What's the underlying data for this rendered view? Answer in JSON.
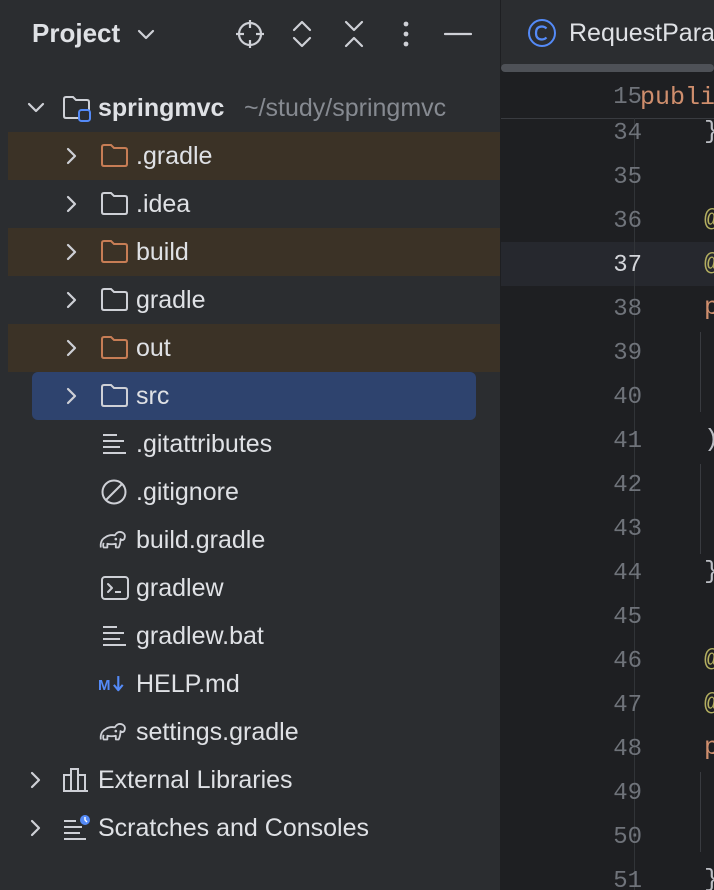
{
  "panel": {
    "title": "Project",
    "header_icons": [
      "crosshair-icon",
      "expand-icon",
      "collapse-icon",
      "more-icon",
      "minimize-icon"
    ]
  },
  "tree": {
    "root": {
      "name": "springmvc",
      "path": "~/study/springmvc"
    },
    "items": [
      {
        "label": ".gradle",
        "type": "folder",
        "excluded": true
      },
      {
        "label": ".idea",
        "type": "folder",
        "excluded": false
      },
      {
        "label": "build",
        "type": "folder",
        "excluded": true
      },
      {
        "label": "gradle",
        "type": "folder",
        "excluded": false
      },
      {
        "label": "out",
        "type": "folder",
        "excluded": true
      },
      {
        "label": "src",
        "type": "folder",
        "selected": true
      },
      {
        "label": ".gitattributes",
        "type": "text-file"
      },
      {
        "label": ".gitignore",
        "type": "ignore-file"
      },
      {
        "label": "build.gradle",
        "type": "gradle-file"
      },
      {
        "label": "gradlew",
        "type": "shell-file"
      },
      {
        "label": "gradlew.bat",
        "type": "text-file"
      },
      {
        "label": "HELP.md",
        "type": "markdown-file"
      },
      {
        "label": "settings.gradle",
        "type": "gradle-file"
      }
    ],
    "external_libraries": "External Libraries",
    "scratches": "Scratches and Consoles"
  },
  "editor": {
    "tab_label": "RequestPara",
    "sticky_line": {
      "number": "15",
      "code": "publi"
    },
    "line_numbers": [
      "34",
      "35",
      "36",
      "37",
      "38",
      "39",
      "40",
      "41",
      "42",
      "43",
      "44",
      "45",
      "46",
      "47",
      "48",
      "49",
      "50",
      "51"
    ],
    "current_line": "37",
    "code": {
      "l34": "}",
      "l36": "@",
      "l37": "@",
      "l38": "p",
      "l41": ")",
      "l44": "}",
      "l46": "@",
      "l47": "@",
      "l48": "p",
      "l51": "}"
    }
  },
  "colors": {
    "panel_bg": "#2b2d30",
    "editor_bg": "#1e1f22",
    "excluded_row": "#3b3226",
    "selected_row": "#2e436e",
    "folder_orange": "#c77d55",
    "folder_gray": "#ced0d6",
    "markdown_blue": "#548af7"
  }
}
